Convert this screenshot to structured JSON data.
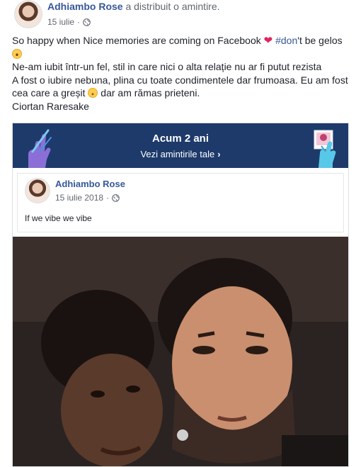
{
  "post": {
    "author": "Adhiambo Rose",
    "action": "a distribuit o amintire.",
    "date": "15 iulie",
    "privacy_icon": "globe-icon",
    "lines": {
      "l1_pre": "So happy when Nice memories are coming on Facebook",
      "l1_hashtag": "#don",
      "l1_post": "'t be gelos",
      "l2": "Ne-am iubit într-un fel, stil in care nici o alta relație nu ar fi putut rezista",
      "l3": "A fost o iubire nebuna, plina cu toate condimentele dar frumoasa. Eu am fost",
      "l4_pre": "cea care a greșit",
      "l4_post": "dar am rămas prieteni.",
      "l5": "Ciortan Raresake"
    }
  },
  "memory": {
    "title": "Acum 2 ani",
    "link": "Vezi amintirile tale",
    "banner_color": "#1d3a6b",
    "shared_post": {
      "author": "Adhiambo Rose",
      "date": "15 iulie 2018",
      "text": "If we vibe we vibe"
    }
  },
  "colors": {
    "link": "#365899",
    "text": "#1d2129",
    "meta": "#616770"
  }
}
